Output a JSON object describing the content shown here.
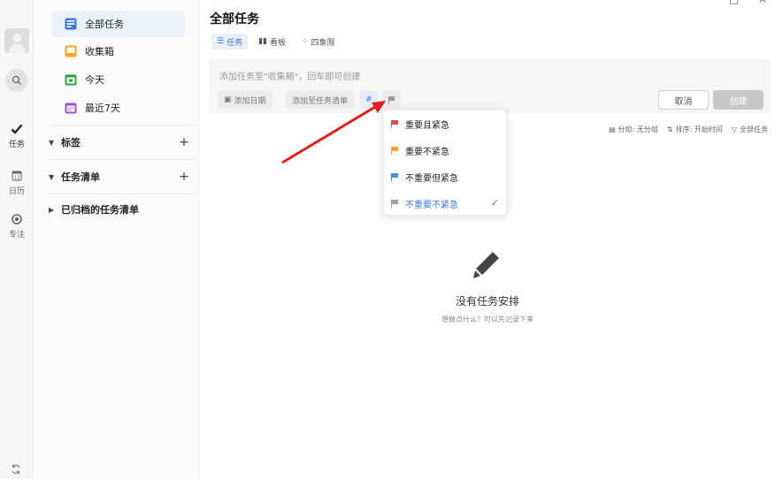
{
  "rail": {
    "items": [
      {
        "label": "任务",
        "icon": "check-icon",
        "active": true
      },
      {
        "label": "日历",
        "icon": "calendar-icon",
        "date": "12"
      },
      {
        "label": "专注",
        "icon": "focus-icon"
      }
    ]
  },
  "sidebar": {
    "items": [
      {
        "label": "全部任务",
        "icon": "all-tasks-icon",
        "color": "#3b78d8",
        "selected": true
      },
      {
        "label": "收集箱",
        "icon": "inbox-icon",
        "color": "#f5a623"
      },
      {
        "label": "今天",
        "icon": "today-icon",
        "color": "#2ea043"
      },
      {
        "label": "最近7天",
        "icon": "week-icon",
        "color": "#9b51e0"
      }
    ],
    "groups": [
      {
        "label": "标签",
        "expanded": true,
        "add": "+"
      },
      {
        "label": "任务清单",
        "expanded": true,
        "add": "+"
      },
      {
        "label": "已归档的任务清单",
        "expanded": false
      }
    ]
  },
  "window": {
    "minimize": "—",
    "maximize": "□",
    "close": "×"
  },
  "main": {
    "title": "全部任务",
    "tabs": [
      {
        "label": "任务",
        "icon": "list-icon",
        "active": true
      },
      {
        "label": "看板",
        "icon": "kanban-icon"
      },
      {
        "label": "四象限",
        "icon": "quadrant-icon"
      }
    ],
    "input": {
      "placeholder": "添加任务至\"收集箱\"，回车即可创建",
      "add_date": "添加日期",
      "add_to_list": "添加至任务清单",
      "tag_symbol": "#",
      "cancel": "取消",
      "create": "创建"
    },
    "toolbar": {
      "group": "分组: 无分组",
      "sort": "排序: 开始时间",
      "filter": "全部任务"
    },
    "priority_menu": [
      {
        "label": "重要且紧急",
        "color": "#e5484d"
      },
      {
        "label": "重要不紧急",
        "color": "#f5a623"
      },
      {
        "label": "不重要但紧急",
        "color": "#4a90e2"
      },
      {
        "label": "不重要不紧急",
        "color": "#9e9e9e",
        "selected": true
      }
    ],
    "empty": {
      "title": "没有任务安排",
      "subtitle": "想做点什么？可以先记录下来"
    }
  },
  "annotation": {
    "arrow_color": "#e02020"
  }
}
